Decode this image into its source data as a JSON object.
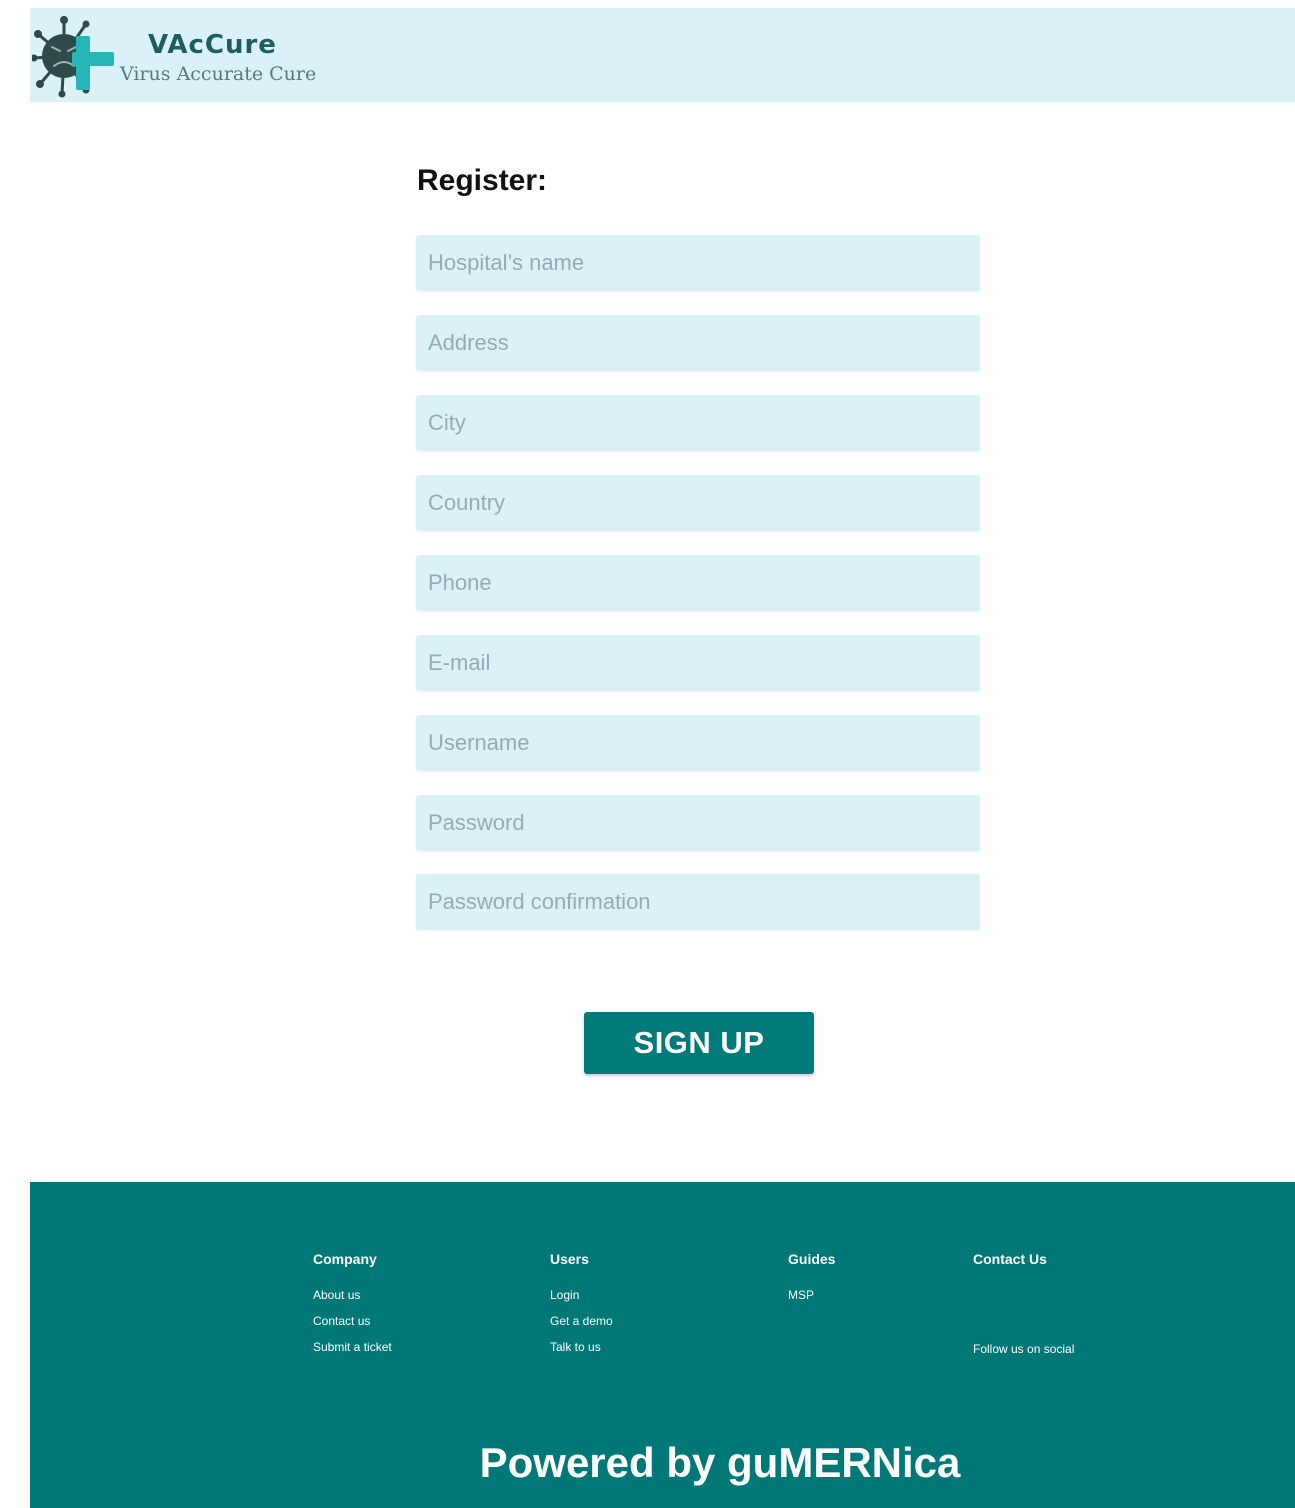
{
  "header": {
    "brand_name": "VAcCure",
    "tagline": "Virus Accurate Cure",
    "logo_icon": "virus-cross-icon"
  },
  "form": {
    "title": "Register:",
    "fields": [
      {
        "placeholder": "Hospital’s name",
        "value": ""
      },
      {
        "placeholder": "Address",
        "value": ""
      },
      {
        "placeholder": "City",
        "value": ""
      },
      {
        "placeholder": "Country",
        "value": ""
      },
      {
        "placeholder": "Phone",
        "value": ""
      },
      {
        "placeholder": "E-mail",
        "value": ""
      },
      {
        "placeholder": "Username",
        "value": ""
      },
      {
        "placeholder": "Password",
        "value": ""
      },
      {
        "placeholder": "Password confirmation",
        "value": ""
      }
    ],
    "submit_label": "SIGN UP"
  },
  "footer": {
    "columns": [
      {
        "heading": "Company",
        "links": [
          "About us",
          "Contact us",
          "Submit a ticket"
        ]
      },
      {
        "heading": "Users",
        "links": [
          "Login",
          "Get a demo",
          "Talk to us"
        ]
      },
      {
        "heading": "Guides",
        "links": [
          "MSP"
        ]
      },
      {
        "heading": "Contact Us",
        "links": []
      }
    ],
    "social_text": "Follow us on social",
    "powered_by": "Powered by guMERNica"
  },
  "colors": {
    "header_bg": "#d9f1f7",
    "field_bg": "#d9f1f7",
    "accent": "#007878",
    "brand_text": "#1e5e5e"
  }
}
